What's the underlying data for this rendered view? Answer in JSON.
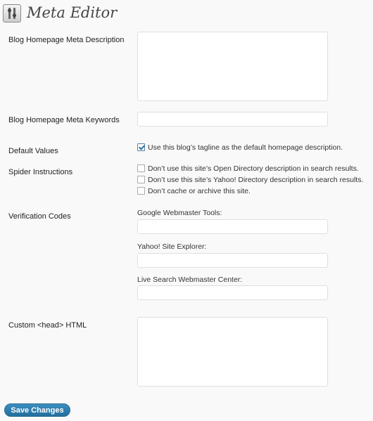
{
  "header": {
    "title": "Meta Editor",
    "icon": "meta-editor-tools-icon"
  },
  "fields": {
    "homepage_description": {
      "label": "Blog Homepage Meta Description",
      "value": ""
    },
    "homepage_keywords": {
      "label": "Blog Homepage Meta Keywords",
      "value": ""
    },
    "default_values": {
      "label": "Default Values",
      "options": [
        {
          "label": "Use this blog’s tagline as the default homepage description.",
          "checked": true
        }
      ]
    },
    "spider_instructions": {
      "label": "Spider Instructions",
      "options": [
        {
          "label": "Don’t use this site’s Open Directory description in search results.",
          "checked": false
        },
        {
          "label": "Don’t use this site’s Yahoo! Directory description in search results.",
          "checked": false
        },
        {
          "label": "Don’t cache or archive this site.",
          "checked": false
        }
      ]
    },
    "verification_codes": {
      "label": "Verification Codes",
      "google": {
        "label": "Google Webmaster Tools:",
        "value": ""
      },
      "yahoo": {
        "label": "Yahoo! Site Explorer:",
        "value": ""
      },
      "live": {
        "label": "Live Search Webmaster Center:",
        "value": ""
      }
    },
    "custom_head": {
      "label": "Custom <head> HTML",
      "value": ""
    }
  },
  "actions": {
    "save_label": "Save Changes"
  },
  "colors": {
    "button": "#2a7aab",
    "background": "#f9f9f9",
    "input_border": "#dfdfdf"
  }
}
